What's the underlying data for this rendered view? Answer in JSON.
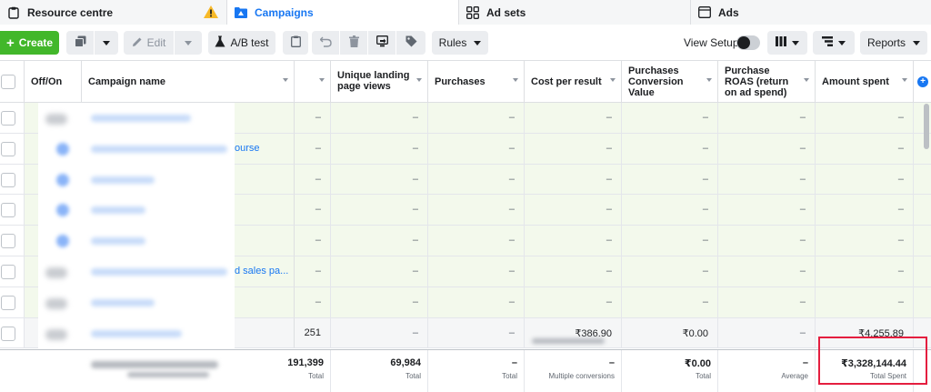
{
  "tabs": [
    {
      "label": "Resource centre",
      "icon": "clipboard-icon"
    },
    {
      "label": "Campaigns",
      "icon": "campaign-folder-icon"
    },
    {
      "label": "Ad sets",
      "icon": "grid-icon"
    },
    {
      "label": "Ads",
      "icon": "ad-window-icon"
    }
  ],
  "toolbar": {
    "create": "Create",
    "edit": "Edit",
    "ab_test": "A/B test",
    "rules": "Rules",
    "view_setup": "View Setup",
    "reports": "Reports"
  },
  "columns": {
    "off_on": "Off/On",
    "campaign_name": "Campaign name",
    "unique_lpv": "Unique landing page views",
    "purchases": "Purchases",
    "cost_per_result": "Cost per result",
    "purchases_conv_value": "Purchases Conversion Value",
    "purchase_roas": "Purchase ROAS (return on ad spend)",
    "amount_spent": "Amount spent"
  },
  "rows": [
    {
      "link_tail": "",
      "c1": "–",
      "c2": "–",
      "c3": "–",
      "c4": "–",
      "c5": "–",
      "c6": "–",
      "c7": "–"
    },
    {
      "link_tail": "ourse",
      "c1": "–",
      "c2": "–",
      "c3": "–",
      "c4": "–",
      "c5": "–",
      "c6": "–",
      "c7": "–"
    },
    {
      "link_tail": "",
      "c1": "–",
      "c2": "–",
      "c3": "–",
      "c4": "–",
      "c5": "–",
      "c6": "–",
      "c7": "–"
    },
    {
      "link_tail": "",
      "c1": "–",
      "c2": "–",
      "c3": "–",
      "c4": "–",
      "c5": "–",
      "c6": "–",
      "c7": "–"
    },
    {
      "link_tail": "",
      "c1": "–",
      "c2": "–",
      "c3": "–",
      "c4": "–",
      "c5": "–",
      "c6": "–",
      "c7": "–"
    },
    {
      "link_tail": "d sales pa...",
      "c1": "–",
      "c2": "–",
      "c3": "–",
      "c4": "–",
      "c5": "–",
      "c6": "–",
      "c7": "–"
    },
    {
      "link_tail": "",
      "c1": "–",
      "c2": "–",
      "c3": "–",
      "c4": "–",
      "c5": "–",
      "c6": "–",
      "c7": "–"
    },
    {
      "link_tail": "",
      "c1": "251",
      "c2": "–",
      "c3": "–",
      "c4": "₹386.90",
      "c5": "₹0.00",
      "c6": "–",
      "c7": "₹4,255.89"
    }
  ],
  "totals": {
    "c1": "191,399",
    "c1_sub": "Total",
    "c2": "69,984",
    "c2_sub": "Total",
    "c3": "–",
    "c3_sub": "Total",
    "c4": "–",
    "c4_sub": "Multiple conversions",
    "c5": "₹0.00",
    "c5_sub": "Total",
    "c6": "–",
    "c6_sub": "Average",
    "c7": "₹3,328,144.44",
    "c7_sub": "Total Spent"
  },
  "colors": {
    "accent": "#1877f2",
    "create_green": "#42b72a",
    "highlight_red": "#e41e3f",
    "row_green": "#f3f9ec"
  }
}
